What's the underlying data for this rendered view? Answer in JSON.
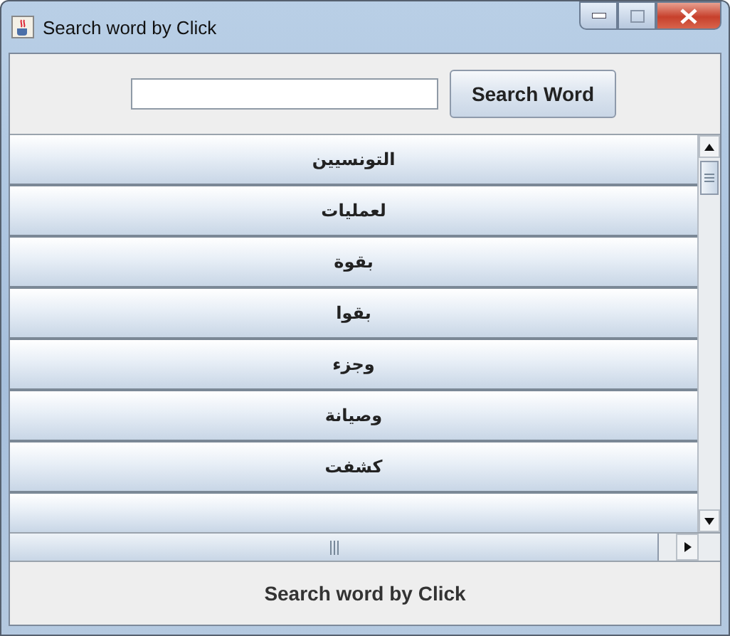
{
  "window": {
    "title": "Search word by Click"
  },
  "search_button": {
    "label": "Search Word"
  },
  "word_list": {
    "items": [
      {
        "label": "التونسيين"
      },
      {
        "label": "لعمليات"
      },
      {
        "label": "بقوة"
      },
      {
        "label": "بقوا"
      },
      {
        "label": "وجزء"
      },
      {
        "label": "وصيانة"
      },
      {
        "label": "كشفت"
      }
    ]
  },
  "status_label": "Search word by Click"
}
